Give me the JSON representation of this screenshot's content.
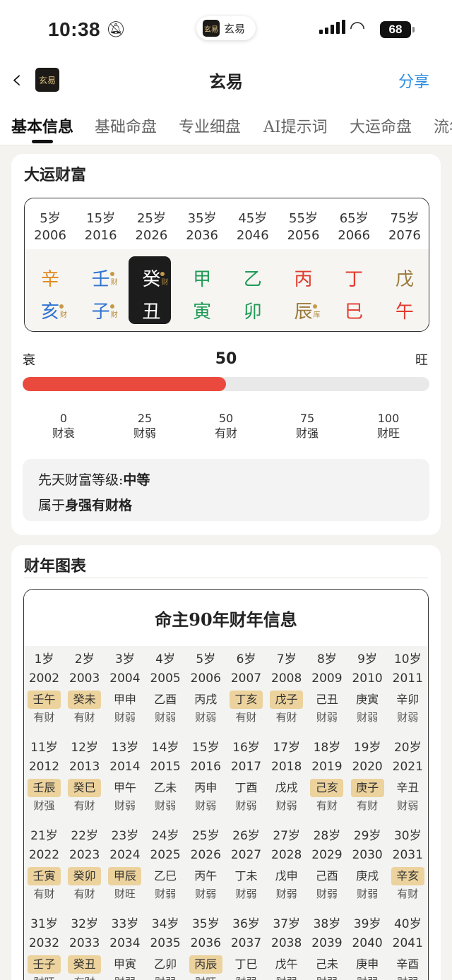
{
  "status": {
    "time": "10:38",
    "battery": "68"
  },
  "island": {
    "logo": "玄易",
    "title": "玄易"
  },
  "nav": {
    "logo": "玄易",
    "title": "玄易",
    "share": "分享"
  },
  "tabs": [
    "基本信息",
    "基础命盘",
    "专业细盘",
    "AI提示词",
    "大运命盘",
    "流年"
  ],
  "dayun": {
    "title": "大运财富",
    "columns": [
      {
        "age": "5岁",
        "year": "2006",
        "gan": "辛",
        "gan_color": "#e08a1e",
        "zhi": "亥",
        "zhi_color": "#2f74d0",
        "gan_tag": "",
        "zhi_tag": "财",
        "highlight": false
      },
      {
        "age": "15岁",
        "year": "2016",
        "gan": "壬",
        "gan_color": "#2f74d0",
        "zhi": "子",
        "zhi_color": "#2f74d0",
        "gan_tag": "财",
        "zhi_tag": "财",
        "highlight": false
      },
      {
        "age": "25岁",
        "year": "2026",
        "gan": "癸",
        "gan_color": "#ffffff",
        "zhi": "丑",
        "zhi_color": "#ffffff",
        "gan_tag": "财",
        "zhi_tag": "",
        "highlight": true
      },
      {
        "age": "35岁",
        "year": "2036",
        "gan": "甲",
        "gan_color": "#1f9a56",
        "zhi": "寅",
        "zhi_color": "#1f9a56",
        "gan_tag": "",
        "zhi_tag": "",
        "highlight": false
      },
      {
        "age": "45岁",
        "year": "2046",
        "gan": "乙",
        "gan_color": "#1f9a56",
        "zhi": "卯",
        "zhi_color": "#1f9a56",
        "gan_tag": "",
        "zhi_tag": "",
        "highlight": false
      },
      {
        "age": "55岁",
        "year": "2056",
        "gan": "丙",
        "gan_color": "#e23a2e",
        "zhi": "辰",
        "zhi_color": "#9a7a3a",
        "gan_tag": "",
        "zhi_tag": "库",
        "highlight": false
      },
      {
        "age": "65岁",
        "year": "2066",
        "gan": "丁",
        "gan_color": "#e23a2e",
        "zhi": "巳",
        "zhi_color": "#e23a2e",
        "gan_tag": "",
        "zhi_tag": "",
        "highlight": false
      },
      {
        "age": "75岁",
        "year": "2076",
        "gan": "戊",
        "gan_color": "#9a7a3a",
        "zhi": "午",
        "zhi_color": "#e23a2e",
        "gan_tag": "",
        "zhi_tag": "",
        "highlight": false
      }
    ],
    "scale_low": "衰",
    "scale_high": "旺",
    "score": "50",
    "score_fraction": 0.5,
    "ticks": [
      {
        "v": "0",
        "l": "财衰"
      },
      {
        "v": "25",
        "l": "财弱"
      },
      {
        "v": "50",
        "l": "有财"
      },
      {
        "v": "75",
        "l": "财强"
      },
      {
        "v": "100",
        "l": "财旺"
      }
    ],
    "level_label": "先天财富等级:",
    "level_value": "中等",
    "pattern_label": "属于",
    "pattern_value": "身强有财格"
  },
  "chart": {
    "title": "财年图表",
    "header": "命主90年财年信息",
    "rows": [
      [
        {
          "a": "1岁",
          "y": "2002",
          "g": "壬午",
          "h": true,
          "s": "有财"
        },
        {
          "a": "2岁",
          "y": "2003",
          "g": "癸未",
          "h": true,
          "s": "有财"
        },
        {
          "a": "3岁",
          "y": "2004",
          "g": "甲申",
          "h": false,
          "s": "财弱"
        },
        {
          "a": "4岁",
          "y": "2005",
          "g": "乙酉",
          "h": false,
          "s": "财弱"
        },
        {
          "a": "5岁",
          "y": "2006",
          "g": "丙戌",
          "h": false,
          "s": "财弱"
        },
        {
          "a": "6岁",
          "y": "2007",
          "g": "丁亥",
          "h": true,
          "s": "有财"
        },
        {
          "a": "7岁",
          "y": "2008",
          "g": "戊子",
          "h": true,
          "s": "有财"
        },
        {
          "a": "8岁",
          "y": "2009",
          "g": "己丑",
          "h": false,
          "s": "财弱"
        },
        {
          "a": "9岁",
          "y": "2010",
          "g": "庚寅",
          "h": false,
          "s": "财弱"
        },
        {
          "a": "10岁",
          "y": "2011",
          "g": "辛卯",
          "h": false,
          "s": "财弱"
        }
      ],
      [
        {
          "a": "11岁",
          "y": "2012",
          "g": "壬辰",
          "h": true,
          "s": "财强"
        },
        {
          "a": "12岁",
          "y": "2013",
          "g": "癸巳",
          "h": true,
          "s": "有财"
        },
        {
          "a": "13岁",
          "y": "2014",
          "g": "甲午",
          "h": false,
          "s": "财弱"
        },
        {
          "a": "14岁",
          "y": "2015",
          "g": "乙未",
          "h": false,
          "s": "财弱"
        },
        {
          "a": "15岁",
          "y": "2016",
          "g": "丙申",
          "h": false,
          "s": "财弱"
        },
        {
          "a": "16岁",
          "y": "2017",
          "g": "丁酉",
          "h": false,
          "s": "财弱"
        },
        {
          "a": "17岁",
          "y": "2018",
          "g": "戊戌",
          "h": false,
          "s": "财弱"
        },
        {
          "a": "18岁",
          "y": "2019",
          "g": "己亥",
          "h": true,
          "s": "有财"
        },
        {
          "a": "19岁",
          "y": "2020",
          "g": "庚子",
          "h": true,
          "s": "有财"
        },
        {
          "a": "20岁",
          "y": "2021",
          "g": "辛丑",
          "h": false,
          "s": "财弱"
        }
      ],
      [
        {
          "a": "21岁",
          "y": "2022",
          "g": "壬寅",
          "h": true,
          "s": "有财"
        },
        {
          "a": "22岁",
          "y": "2023",
          "g": "癸卯",
          "h": true,
          "s": "有财"
        },
        {
          "a": "23岁",
          "y": "2024",
          "g": "甲辰",
          "h": true,
          "s": "财旺"
        },
        {
          "a": "24岁",
          "y": "2025",
          "g": "乙巳",
          "h": false,
          "s": "财弱"
        },
        {
          "a": "25岁",
          "y": "2026",
          "g": "丙午",
          "h": false,
          "s": "财弱"
        },
        {
          "a": "26岁",
          "y": "2027",
          "g": "丁未",
          "h": false,
          "s": "财弱"
        },
        {
          "a": "27岁",
          "y": "2028",
          "g": "戊申",
          "h": false,
          "s": "财弱"
        },
        {
          "a": "28岁",
          "y": "2029",
          "g": "己酉",
          "h": false,
          "s": "财弱"
        },
        {
          "a": "29岁",
          "y": "2030",
          "g": "庚戌",
          "h": false,
          "s": "财弱"
        },
        {
          "a": "30岁",
          "y": "2031",
          "g": "辛亥",
          "h": true,
          "s": "有财"
        }
      ],
      [
        {
          "a": "31岁",
          "y": "2032",
          "g": "壬子",
          "h": true,
          "s": "财旺"
        },
        {
          "a": "32岁",
          "y": "2033",
          "g": "癸丑",
          "h": true,
          "s": "有财"
        },
        {
          "a": "33岁",
          "y": "2034",
          "g": "甲寅",
          "h": false,
          "s": "财弱"
        },
        {
          "a": "34岁",
          "y": "2035",
          "g": "乙卯",
          "h": false,
          "s": "财弱"
        },
        {
          "a": "35岁",
          "y": "2036",
          "g": "丙辰",
          "h": true,
          "s": "财旺"
        },
        {
          "a": "36岁",
          "y": "2037",
          "g": "丁巳",
          "h": false,
          "s": "财弱"
        },
        {
          "a": "37岁",
          "y": "2038",
          "g": "戊午",
          "h": false,
          "s": "财弱"
        },
        {
          "a": "38岁",
          "y": "2039",
          "g": "己未",
          "h": false,
          "s": "财弱"
        },
        {
          "a": "39岁",
          "y": "2040",
          "g": "庚申",
          "h": false,
          "s": "财弱"
        },
        {
          "a": "40岁",
          "y": "2041",
          "g": "辛酉",
          "h": false,
          "s": "财弱"
        }
      ]
    ]
  }
}
